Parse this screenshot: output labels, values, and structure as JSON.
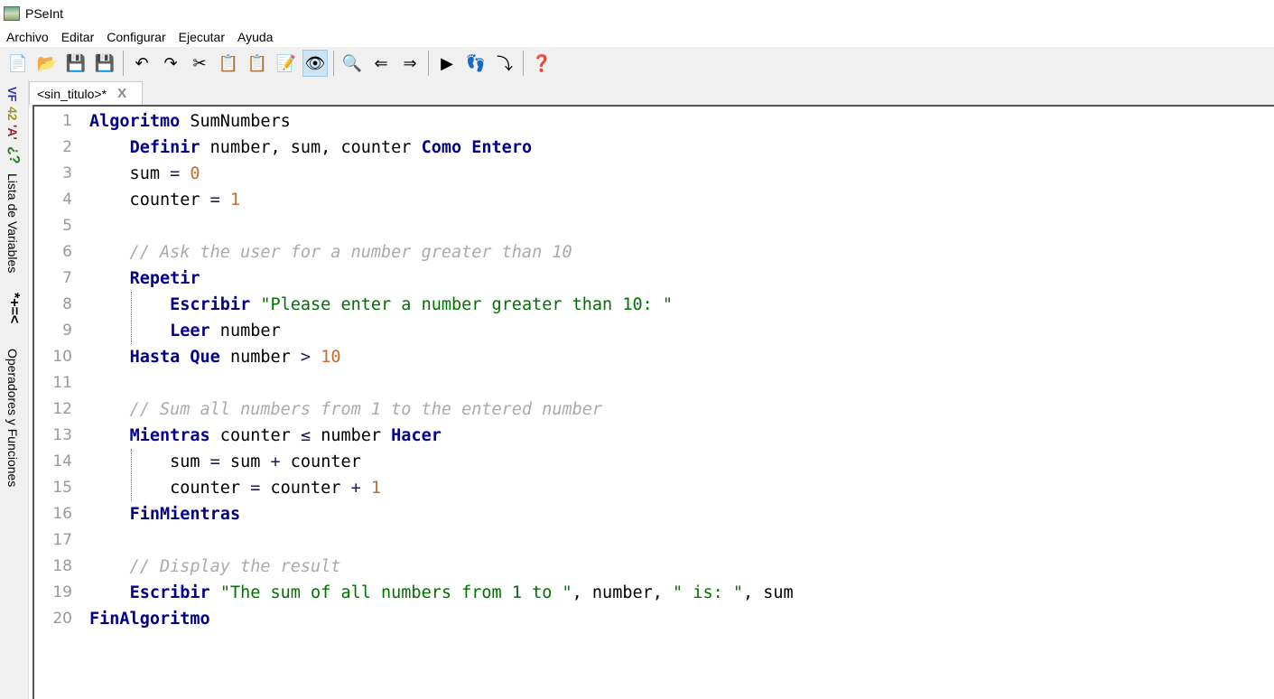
{
  "window": {
    "title": "PSeInt"
  },
  "menu": [
    "Archivo",
    "Editar",
    "Configurar",
    "Ejecutar",
    "Ayuda"
  ],
  "toolbar": [
    {
      "name": "new-file-icon",
      "glyph": "📄"
    },
    {
      "name": "open-file-icon",
      "glyph": "📂"
    },
    {
      "name": "save-icon",
      "glyph": "💾"
    },
    {
      "name": "save-as-icon",
      "glyph": "💾"
    },
    "sep",
    {
      "name": "undo-icon",
      "glyph": "↶"
    },
    {
      "name": "redo-icon",
      "glyph": "↷"
    },
    {
      "name": "cut-icon",
      "glyph": "✂"
    },
    {
      "name": "copy-icon",
      "glyph": "📋"
    },
    {
      "name": "paste-icon",
      "glyph": "📋"
    },
    {
      "name": "indent-icon",
      "glyph": "📝"
    },
    {
      "name": "debug-watch-icon",
      "glyph": "👁",
      "active": true
    },
    "sep",
    {
      "name": "find-icon",
      "glyph": "🔍"
    },
    {
      "name": "find-previous-icon",
      "glyph": "⇐"
    },
    {
      "name": "find-next-icon",
      "glyph": "⇒"
    },
    "sep",
    {
      "name": "run-icon",
      "glyph": "▶"
    },
    {
      "name": "step-by-step-icon",
      "glyph": "👣"
    },
    {
      "name": "flowchart-icon",
      "glyph": "⤵"
    },
    "sep",
    {
      "name": "help-icon",
      "glyph": "❓"
    }
  ],
  "sidebar": {
    "var_icons": "VF",
    "num_icon": "42",
    "str_icon": "'A'",
    "logic_icon": "¿?",
    "variables_label": "Lista de Variables",
    "ops_icon": "*+=<",
    "operators_label": "Operadores y Funciones"
  },
  "tab": {
    "label": "<sin_titulo>*",
    "close": "X"
  },
  "colors": {
    "keyword": "#00008b",
    "number": "#c96a2a",
    "string": "#007000",
    "comment": "#aaaaaa"
  },
  "code": [
    [
      {
        "t": "kw",
        "v": "Algoritmo"
      },
      {
        "t": "id",
        "v": " SumNumbers"
      }
    ],
    [
      {
        "t": "id",
        "v": "    "
      },
      {
        "t": "kw",
        "v": "Definir"
      },
      {
        "t": "id",
        "v": " number, sum, counter "
      },
      {
        "t": "kw",
        "v": "Como Entero"
      }
    ],
    [
      {
        "t": "id",
        "v": "    sum "
      },
      {
        "t": "op",
        "v": "="
      },
      {
        "t": "id",
        "v": " "
      },
      {
        "t": "num",
        "v": "0"
      }
    ],
    [
      {
        "t": "id",
        "v": "    counter "
      },
      {
        "t": "op",
        "v": "="
      },
      {
        "t": "id",
        "v": " "
      },
      {
        "t": "num",
        "v": "1"
      }
    ],
    [],
    [
      {
        "t": "com",
        "v": "    // Ask the user for a number greater than 10"
      }
    ],
    [
      {
        "t": "id",
        "v": "    "
      },
      {
        "t": "kw",
        "v": "Repetir"
      }
    ],
    [
      {
        "t": "id",
        "v": "        "
      },
      {
        "t": "kw",
        "v": "Escribir"
      },
      {
        "t": "id",
        "v": " "
      },
      {
        "t": "str",
        "v": "\"Please enter a number greater than 10: \""
      }
    ],
    [
      {
        "t": "id",
        "v": "        "
      },
      {
        "t": "kw",
        "v": "Leer"
      },
      {
        "t": "id",
        "v": " number"
      }
    ],
    [
      {
        "t": "id",
        "v": "    "
      },
      {
        "t": "kw",
        "v": "Hasta Que"
      },
      {
        "t": "id",
        "v": " number "
      },
      {
        "t": "op",
        "v": ">"
      },
      {
        "t": "id",
        "v": " "
      },
      {
        "t": "num",
        "v": "10"
      }
    ],
    [],
    [
      {
        "t": "com",
        "v": "    // Sum all numbers from 1 to the entered number"
      }
    ],
    [
      {
        "t": "id",
        "v": "    "
      },
      {
        "t": "kw",
        "v": "Mientras"
      },
      {
        "t": "id",
        "v": " counter "
      },
      {
        "t": "op",
        "v": "≤"
      },
      {
        "t": "id",
        "v": " number "
      },
      {
        "t": "kw",
        "v": "Hacer"
      }
    ],
    [
      {
        "t": "id",
        "v": "        sum "
      },
      {
        "t": "op",
        "v": "="
      },
      {
        "t": "id",
        "v": " sum "
      },
      {
        "t": "op",
        "v": "+"
      },
      {
        "t": "id",
        "v": " counter"
      }
    ],
    [
      {
        "t": "id",
        "v": "        counter "
      },
      {
        "t": "op",
        "v": "="
      },
      {
        "t": "id",
        "v": " counter "
      },
      {
        "t": "op",
        "v": "+"
      },
      {
        "t": "id",
        "v": " "
      },
      {
        "t": "num",
        "v": "1"
      }
    ],
    [
      {
        "t": "id",
        "v": "    "
      },
      {
        "t": "kw",
        "v": "FinMientras"
      }
    ],
    [],
    [
      {
        "t": "com",
        "v": "    // Display the result"
      }
    ],
    [
      {
        "t": "id",
        "v": "    "
      },
      {
        "t": "kw",
        "v": "Escribir"
      },
      {
        "t": "id",
        "v": " "
      },
      {
        "t": "str",
        "v": "\"The sum of all numbers from 1 to \""
      },
      {
        "t": "id",
        "v": ", number, "
      },
      {
        "t": "str",
        "v": "\" is: \""
      },
      {
        "t": "id",
        "v": ", sum"
      }
    ],
    [
      {
        "t": "kw",
        "v": "FinAlgoritmo"
      }
    ]
  ]
}
